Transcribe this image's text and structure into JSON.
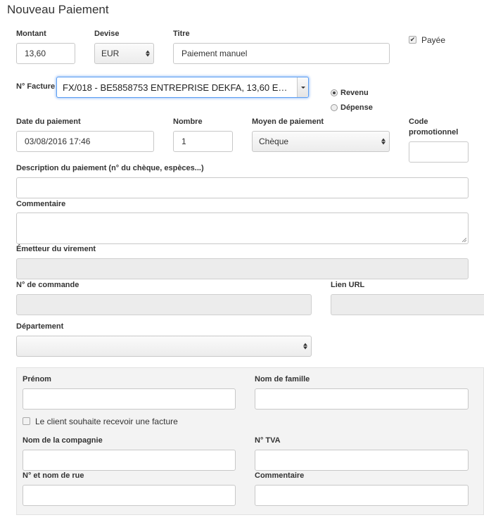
{
  "page_title": "Nouveau Paiement",
  "amount": {
    "label": "Montant",
    "value": "13,60"
  },
  "currency": {
    "label": "Devise",
    "value": "EUR"
  },
  "title_field": {
    "label": "Titre",
    "value": "Paiement manuel"
  },
  "paid": {
    "label": "Payée",
    "checked": true
  },
  "invoice": {
    "label": "N° Facture",
    "value": "FX/018 - BE5858753 ENTREPRISE DEKFA, 13,60 EUR..."
  },
  "direction": {
    "options": [
      "Revenu",
      "Dépense"
    ],
    "selected": "Revenu"
  },
  "payment_date": {
    "label": "Date du paiement",
    "value": "03/08/2016 17:46"
  },
  "number": {
    "label": "Nombre",
    "value": "1"
  },
  "payment_method": {
    "label": "Moyen de paiement",
    "value": "Chèque"
  },
  "promo_code": {
    "label_line1": "Code",
    "label_line2": "promotionnel",
    "value": ""
  },
  "description": {
    "label": "Description du paiement (n° du chèque, espèces...)",
    "value": ""
  },
  "comment": {
    "label": "Commentaire",
    "value": ""
  },
  "transfer_issuer": {
    "label": "Émetteur du virement",
    "value": ""
  },
  "order_number": {
    "label": "N° de commande",
    "value": ""
  },
  "url_link": {
    "label": "Lien URL",
    "value": ""
  },
  "department": {
    "label": "Département",
    "value": ""
  },
  "customer": {
    "first_name": {
      "label": "Prénom",
      "value": ""
    },
    "last_name": {
      "label": "Nom de famille",
      "value": ""
    },
    "wants_invoice": {
      "label": "Le client souhaite recevoir une facture",
      "checked": false
    },
    "company_name": {
      "label": "Nom de la compagnie",
      "value": ""
    },
    "vat": {
      "label": "N° TVA",
      "value": ""
    },
    "street": {
      "label": "N° et nom de rue",
      "value": ""
    },
    "comment": {
      "label": "Commentaire",
      "value": ""
    }
  }
}
